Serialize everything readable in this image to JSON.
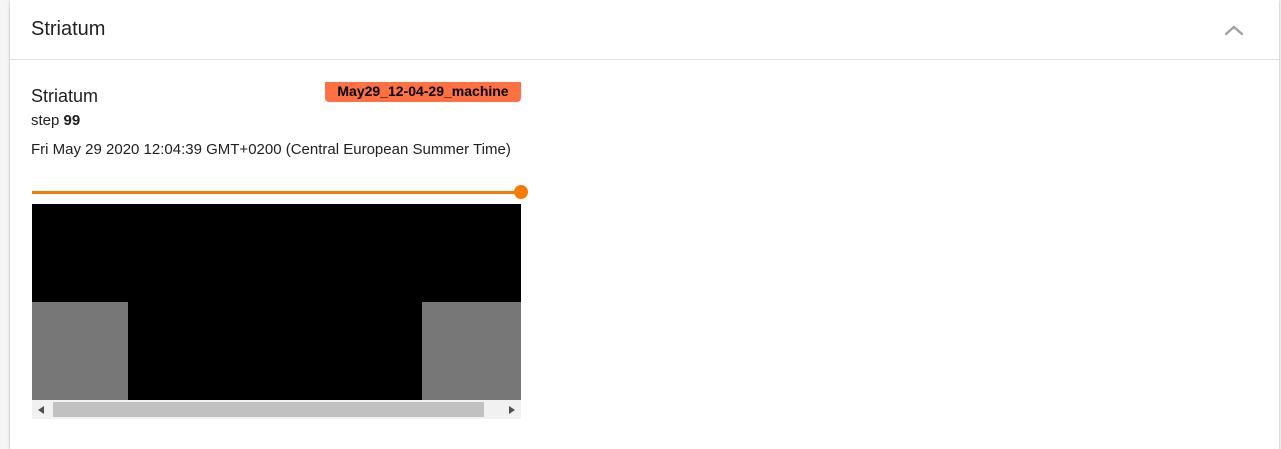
{
  "pane": {
    "title": "Striatum"
  },
  "card": {
    "title": "Striatum",
    "run_name": "May29_12-04-29_machine",
    "step_label": "step",
    "step_value": "99",
    "timestamp": "Fri May 29 2020 12:04:39 GMT+0200 (Central European Summer Time)",
    "slider_fraction": 1.0
  },
  "icons": {
    "collapse": "chevron-up-icon",
    "scroll_left": "triangle-left-icon",
    "scroll_right": "triangle-right-icon"
  },
  "colors": {
    "run_badge": "#ff7043",
    "slider": "#f57c00",
    "image_background": "#000000",
    "image_block": "#777777"
  }
}
